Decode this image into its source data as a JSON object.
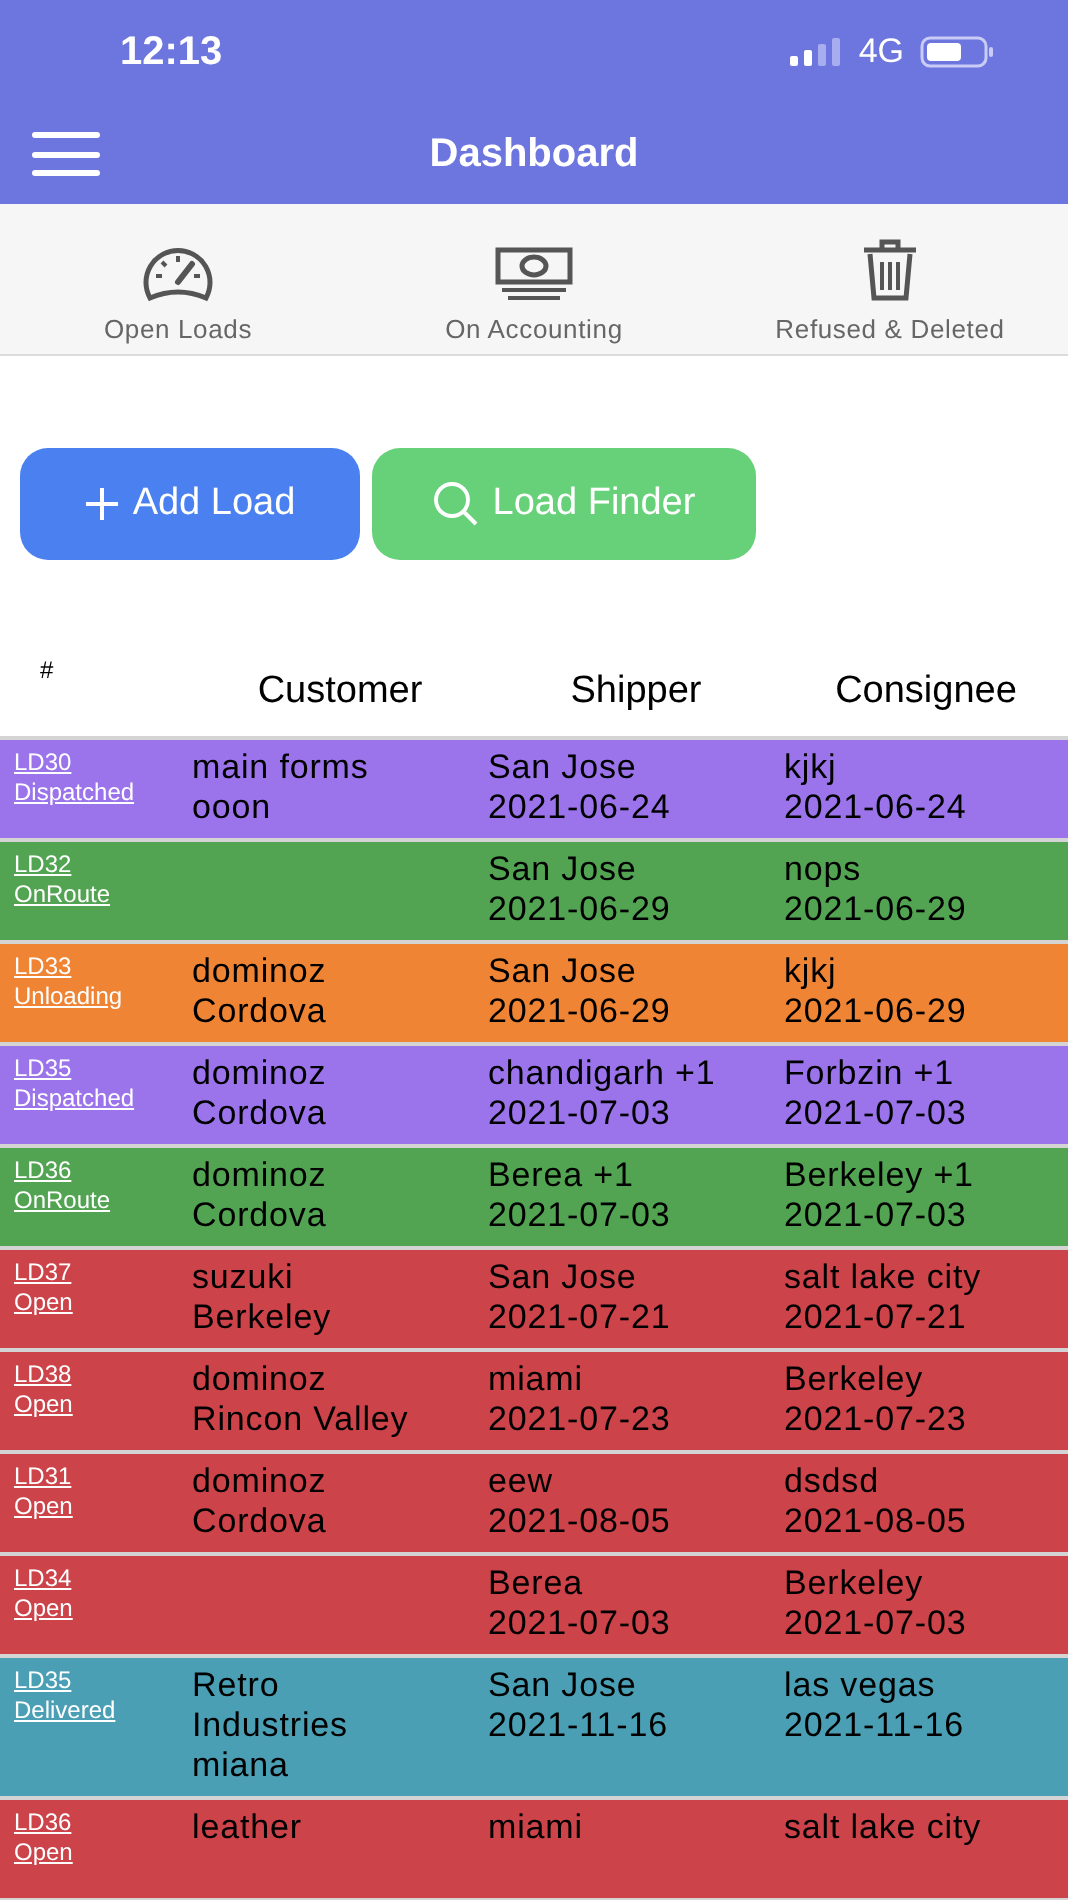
{
  "status_bar": {
    "time": "12:13",
    "network": "4G"
  },
  "header": {
    "title": "Dashboard"
  },
  "tabs": [
    {
      "label": "Open Loads",
      "kind": "gauge"
    },
    {
      "label": "On Accounting",
      "kind": "money"
    },
    {
      "label": "Refused & Deleted",
      "kind": "trash"
    }
  ],
  "actions": [
    {
      "label": "Add Load",
      "kind": "add"
    },
    {
      "label": "Load Finder",
      "kind": "search"
    }
  ],
  "table": {
    "columns": [
      "#",
      "Customer",
      "Shipper",
      "Consignee"
    ],
    "rows": [
      {
        "id": "LD30",
        "status": "Dispatched",
        "color": "#9b74eb",
        "customer": [
          "main forms",
          "ooon"
        ],
        "shipper": [
          "San Jose",
          "2021-06-24"
        ],
        "consignee": [
          "kjkj",
          "2021-06-24"
        ]
      },
      {
        "id": "LD32",
        "status": "OnRoute",
        "color": "#52a452",
        "customer": [],
        "shipper": [
          "San Jose",
          "2021-06-29"
        ],
        "consignee": [
          "nops",
          "2021-06-29"
        ]
      },
      {
        "id": "LD33",
        "status": "Unloading",
        "color": "#ee8434",
        "customer": [
          "dominoz",
          "Cordova"
        ],
        "shipper": [
          "San Jose",
          "2021-06-29"
        ],
        "consignee": [
          "kjkj",
          "2021-06-29"
        ]
      },
      {
        "id": "LD35",
        "status": "Dispatched",
        "color": "#9b74eb",
        "customer": [
          "dominoz",
          "Cordova"
        ],
        "shipper": [
          "chandigarh +1",
          "2021-07-03"
        ],
        "consignee": [
          "Forbzin +1",
          "2021-07-03"
        ]
      },
      {
        "id": "LD36",
        "status": "OnRoute",
        "color": "#52a452",
        "customer": [
          "dominoz",
          "Cordova"
        ],
        "shipper": [
          "Berea +1",
          "2021-07-03"
        ],
        "consignee": [
          "Berkeley +1",
          "2021-07-03"
        ]
      },
      {
        "id": "LD37",
        "status": "Open",
        "color": "#cc434a",
        "customer": [
          "suzuki",
          "Berkeley"
        ],
        "shipper": [
          "San Jose",
          "2021-07-21"
        ],
        "consignee": [
          "salt lake city",
          "2021-07-21"
        ]
      },
      {
        "id": "LD38",
        "status": "Open",
        "color": "#cc434a",
        "customer": [
          "dominoz",
          "Rincon Valley"
        ],
        "shipper": [
          "miami",
          "2021-07-23"
        ],
        "consignee": [
          "Berkeley",
          "2021-07-23"
        ]
      },
      {
        "id": "LD31",
        "status": "Open",
        "color": "#cc434a",
        "customer": [
          "dominoz",
          "Cordova"
        ],
        "shipper": [
          "eew",
          "2021-08-05"
        ],
        "consignee": [
          "dsdsd",
          "2021-08-05"
        ]
      },
      {
        "id": "LD34",
        "status": "Open",
        "color": "#cc434a",
        "customer": [],
        "shipper": [
          "Berea",
          "2021-07-03"
        ],
        "consignee": [
          "Berkeley",
          "2021-07-03"
        ]
      },
      {
        "id": "LD35",
        "status": "Delivered",
        "color": "#4a9fb5",
        "customer": [
          "Retro",
          "Industries",
          "miana"
        ],
        "shipper": [
          "San Jose",
          "2021-11-16"
        ],
        "consignee": [
          "las vegas",
          "2021-11-16"
        ]
      },
      {
        "id": "LD36",
        "status": "Open",
        "color": "#cc434a",
        "customer": [
          "leather"
        ],
        "shipper": [
          "miami"
        ],
        "consignee": [
          "salt lake city"
        ]
      }
    ]
  }
}
